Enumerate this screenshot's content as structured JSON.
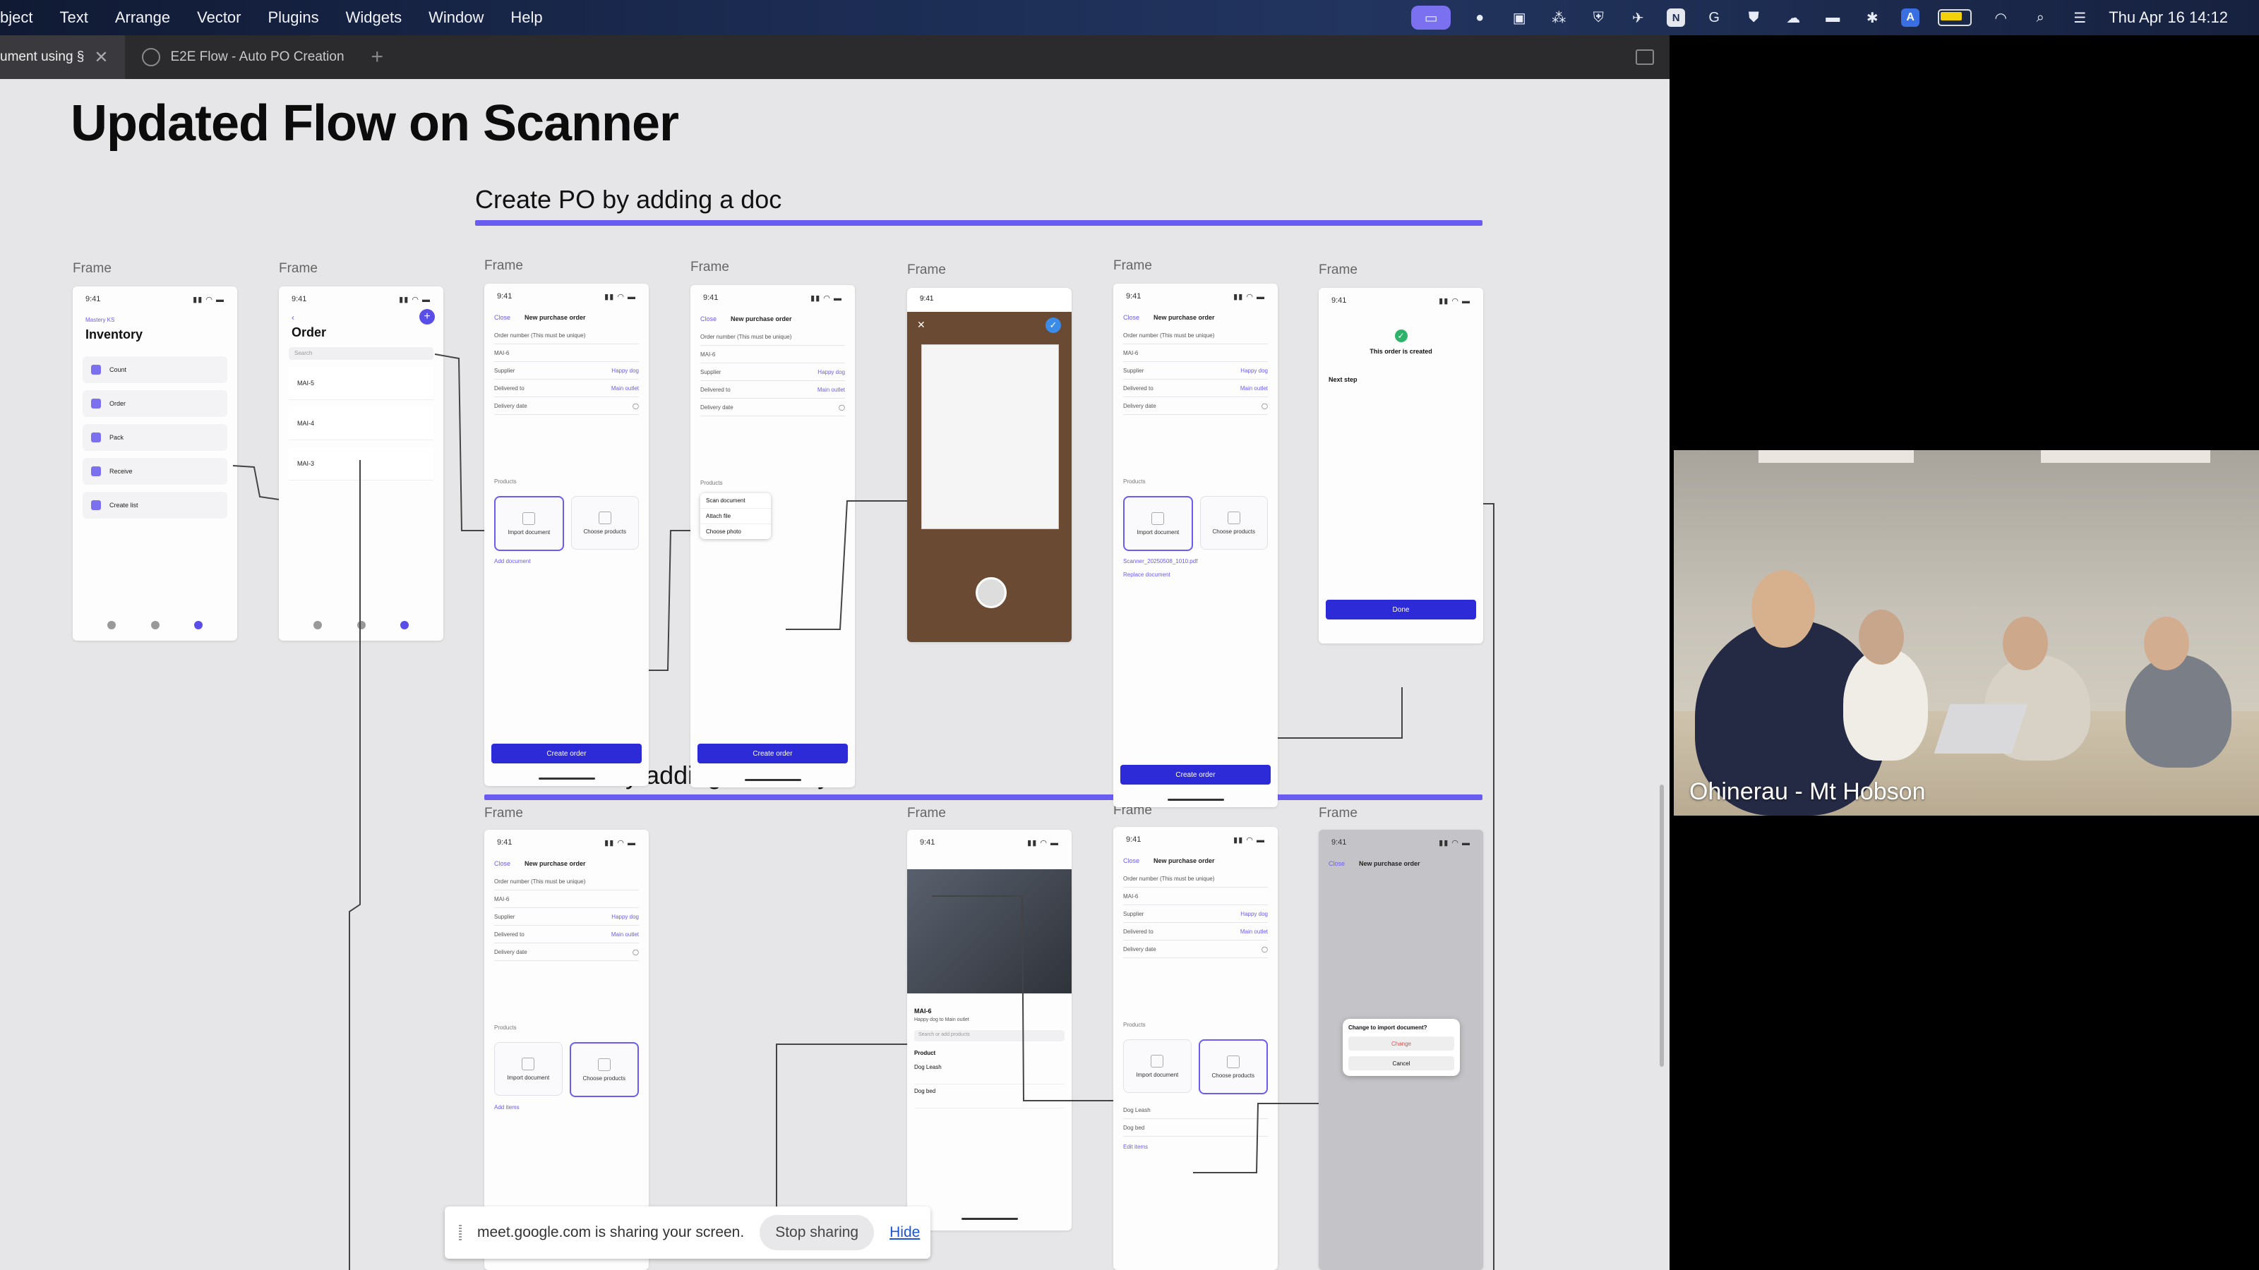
{
  "menubar": {
    "items": [
      "bject",
      "Text",
      "Arrange",
      "Vector",
      "Plugins",
      "Widgets",
      "Window",
      "Help"
    ],
    "clock": "Thu Apr 16  14:12",
    "status_icons": [
      "screen-share-icon",
      "messages-icon",
      "notes-icon",
      "grid-icon",
      "shield-icon",
      "airplane-icon",
      "notion-icon",
      "grammarly-icon",
      "vpn-icon",
      "cloud-icon",
      "display-icon",
      "bluetooth-icon",
      "azure-icon",
      "battery-icon",
      "wifi-icon",
      "search-icon",
      "control-center-icon"
    ]
  },
  "tabs": [
    {
      "label": "ument using §"
    },
    {
      "label": "E2E Flow - Auto PO Creation"
    }
  ],
  "canvas": {
    "title": "Updated Flow on Scanner",
    "section_doc": "Create PO by adding a doc",
    "section_manual": "Create PO by adding manually",
    "frame_label": "Frame"
  },
  "screens": {
    "status_time": "9:41",
    "inventory": {
      "brand": "Mastery KS",
      "title": "Inventory",
      "items": [
        "Count",
        "Order",
        "Pack",
        "Receive",
        "Create list"
      ]
    },
    "order": {
      "title": "Order",
      "search": "Search",
      "items": [
        "MAI-5",
        "MAI-4",
        "MAI-3"
      ]
    },
    "po_form": {
      "close": "Close",
      "title": "New purchase order",
      "order_number_label": "Order number (This must be unique)",
      "order_number": "MAI-6",
      "supplier": "Supplier",
      "supplier_value": "Happy dog",
      "delivered_to": "Delivered to",
      "delivered_value": "Main outlet",
      "delivery_date": "Delivery date",
      "products": "Products",
      "import_doc": "Import document",
      "choose_products": "Choose products",
      "add_document": "Add document",
      "add_items": "Add items",
      "create_order": "Create order",
      "replace_document": "Replace document",
      "file_name": "Scanner_20250508_1010.pdf",
      "edit_items": "Edit items"
    },
    "attach_menu": [
      "Scan document",
      "Attach file",
      "Choose photo"
    ],
    "created": {
      "title": "This order is created",
      "next_step": "Next step",
      "done": "Done"
    },
    "scanner": {
      "order": "MAI-6",
      "sub": "Happy dog to Main outlet",
      "search": "Search or add products",
      "product_header": "Product",
      "products": [
        "Dog Leash",
        "Dog bed"
      ]
    },
    "modal": {
      "title": "Change to import document?",
      "change": "Change",
      "cancel": "Cancel"
    }
  },
  "share_bar": {
    "message": "meet.google.com is sharing your screen.",
    "stop": "Stop sharing",
    "hide": "Hide"
  },
  "video": {
    "participant": "Ohinerau - Mt Hobson"
  },
  "colors": {
    "accent": "#6a5cf0",
    "primary_button": "#2d2ad8",
    "canvas_bg": "#e6e6e8"
  }
}
